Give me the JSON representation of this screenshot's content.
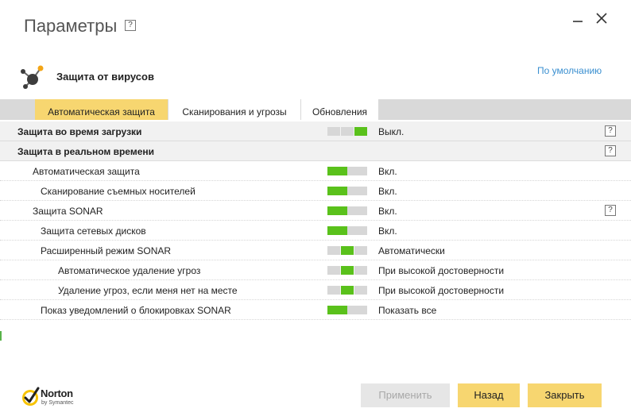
{
  "window": {
    "title": "Параметры",
    "help_label": "?"
  },
  "section": {
    "title": "Защита от вирусов",
    "default_link": "По умолчанию"
  },
  "tabs": [
    {
      "label": "Автоматическая защита",
      "active": true
    },
    {
      "label": "Сканирования и угрозы",
      "active": false
    },
    {
      "label": "Обновления",
      "active": false
    }
  ],
  "rows": [
    {
      "label": "Защита во время загрузки",
      "value": "Выкл.",
      "state": "off",
      "help": "?"
    },
    {
      "label": "Защита в реальном времени",
      "help": "?"
    },
    {
      "label": "Автоматическая защита",
      "value": "Вкл.",
      "state": "on"
    },
    {
      "label": "Сканирование съемных носителей",
      "value": "Вкл.",
      "state": "on"
    },
    {
      "label": "Защита SONAR",
      "value": "Вкл.",
      "state": "on",
      "help": "?"
    },
    {
      "label": "Защита сетевых дисков",
      "value": "Вкл.",
      "state": "on"
    },
    {
      "label": "Расширенный режим SONAR",
      "value": "Автоматически",
      "state": "middle"
    },
    {
      "label": "Автоматическое удаление угроз",
      "value": "При высокой достоверности",
      "state": "middle"
    },
    {
      "label": "Удаление угроз, если меня нет на месте",
      "value": "При высокой достоверности",
      "state": "middle"
    },
    {
      "label": "Показ уведомлений о блокировках SONAR",
      "value": "Показать все",
      "state": "on"
    }
  ],
  "footer": {
    "brand_name": "Norton",
    "brand_sub": "by Symantec",
    "apply_label": "Применить",
    "back_label": "Назад",
    "close_label": "Закрыть"
  },
  "colors": {
    "accent": "#f7d670",
    "toggle_on": "#5ac11b",
    "link": "#3a8fd0"
  }
}
